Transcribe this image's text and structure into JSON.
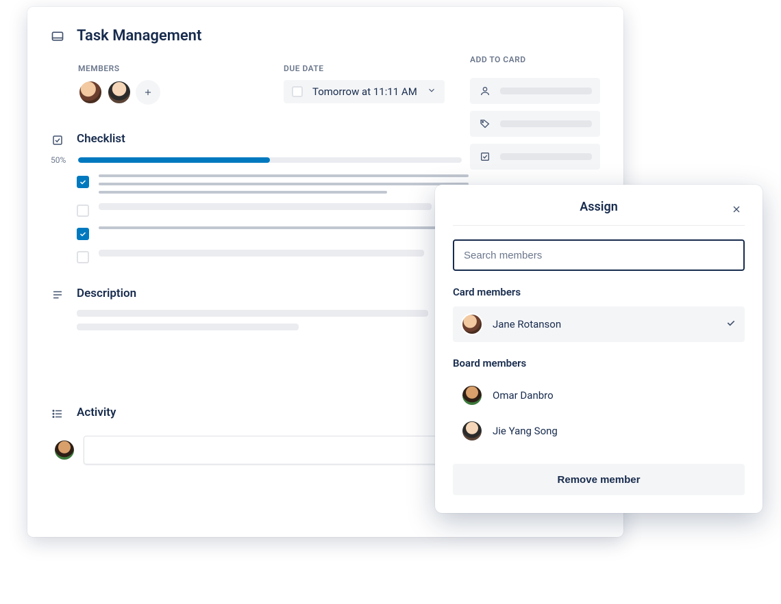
{
  "card": {
    "title": "Task Management",
    "members_label": "MEMBERS",
    "due_date_label": "DUE DATE",
    "due_date_value": "Tomorrow at 11:11 AM",
    "add_to_card_label": "ADD TO CARD"
  },
  "checklist": {
    "title": "Checklist",
    "progress_label": "50%",
    "progress_percent": 50,
    "items": [
      {
        "checked": true
      },
      {
        "checked": false
      },
      {
        "checked": true
      },
      {
        "checked": false
      }
    ]
  },
  "description": {
    "title": "Description"
  },
  "activity": {
    "title": "Activity"
  },
  "assign_popup": {
    "title": "Assign",
    "search_placeholder": "Search members",
    "card_members_label": "Card members",
    "board_members_label": "Board members",
    "card_members": [
      {
        "name": "Jane Rotanson",
        "selected": true
      }
    ],
    "board_members": [
      {
        "name": "Omar Danbro"
      },
      {
        "name": "Jie Yang Song"
      }
    ],
    "remove_label": "Remove member"
  }
}
